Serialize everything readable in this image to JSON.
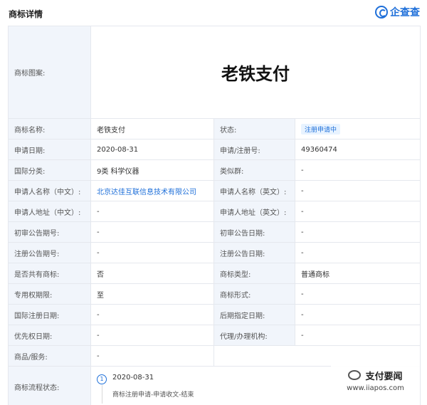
{
  "header": {
    "title": "商标详情",
    "logo_text": "企查查"
  },
  "mark": {
    "label": "商标图案:",
    "text": "老铁支付"
  },
  "rows": [
    {
      "l1": "商标名称:",
      "v1": "老铁支付",
      "l2": "状态:",
      "v2": "注册申请中"
    },
    {
      "l1": "申请日期:",
      "v1": "2020-08-31",
      "l2": "申请/注册号:",
      "v2": "49360474"
    },
    {
      "l1": "国际分类:",
      "v1": "9类 科学仪器",
      "l2": "类似群:",
      "v2": "-"
    },
    {
      "l1": "申请人名称（中文）:",
      "v1": "北京达佳互联信息技术有限公司",
      "l2": "申请人名称（英文）:",
      "v2": "-"
    },
    {
      "l1": "申请人地址（中文）:",
      "v1": "-",
      "l2": "申请人地址（英文）:",
      "v2": "-"
    },
    {
      "l1": "初审公告期号:",
      "v1": "-",
      "l2": "初审公告日期:",
      "v2": "-"
    },
    {
      "l1": "注册公告期号:",
      "v1": "-",
      "l2": "注册公告日期:",
      "v2": "-"
    },
    {
      "l1": "是否共有商标:",
      "v1": "否",
      "l2": "商标类型:",
      "v2": "普通商标"
    },
    {
      "l1": "专用权期限:",
      "v1": "至",
      "l2": "商标形式:",
      "v2": "-"
    },
    {
      "l1": "国际注册日期:",
      "v1": "-",
      "l2": "后期指定日期:",
      "v2": "-"
    },
    {
      "l1": "优先权日期:",
      "v1": "-",
      "l2": "代理/办理机构:",
      "v2": "-"
    }
  ],
  "goods": {
    "label": "商品/服务:",
    "value": "-"
  },
  "flow": {
    "label": "商标流程状态:",
    "step_number": "1",
    "step_date": "2020-08-31",
    "step_desc": "商标注册申请-申请收文-结束"
  },
  "watermark": {
    "name": "支付要闻",
    "url": "www.iiapos.com"
  },
  "colors": {
    "accent": "#1e6fd9",
    "label_bg": "#f1f5fb",
    "border": "#e5e8ee"
  }
}
